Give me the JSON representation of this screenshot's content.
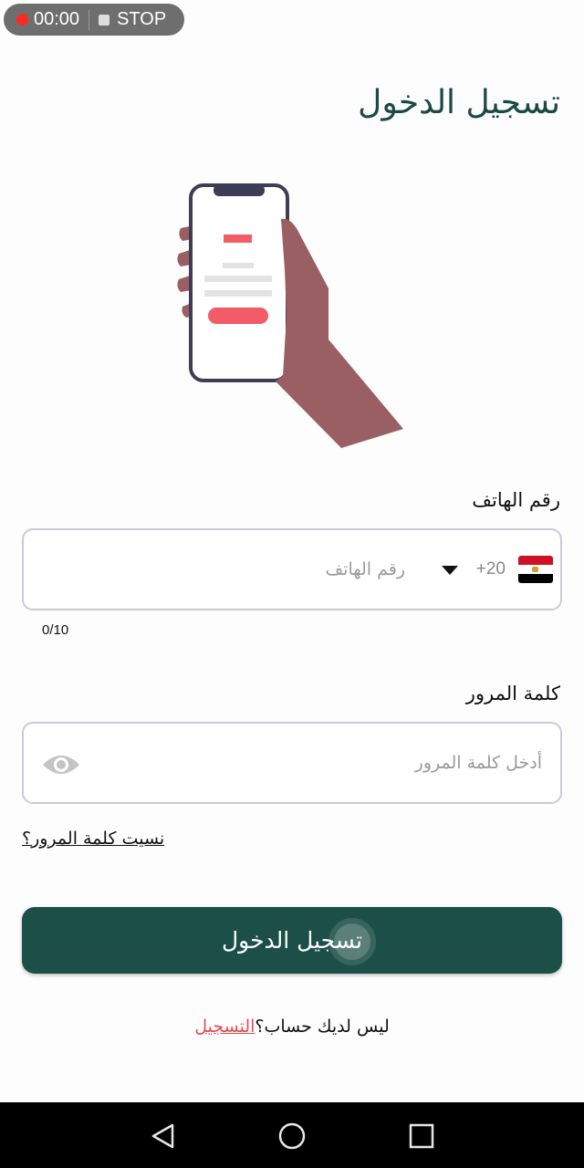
{
  "recorder": {
    "time": "00:00",
    "stop_label": "STOP"
  },
  "title": "تسجيل الدخول",
  "phone": {
    "label": "رقم الهاتف",
    "dial_code": "+20",
    "placeholder": "رقم الهاتف",
    "counter": "0/10",
    "country_flag": "egypt-flag-icon"
  },
  "password": {
    "label": "كلمة المرور",
    "placeholder": "أدخل كلمة المرور"
  },
  "forgot_password": "نسيت كلمة المرور؟",
  "login_button": "تسجيل الدخول",
  "signup": {
    "prompt": "ليس لديك حساب؟",
    "link": "التسجيل"
  },
  "colors": {
    "primary": "#1c4f47",
    "accent": "#e0504f",
    "hand": "#9a5f62",
    "phone_outline": "#3f3d56"
  },
  "nav": {
    "back": "back-icon",
    "home": "home-icon",
    "recents": "recents-icon"
  }
}
